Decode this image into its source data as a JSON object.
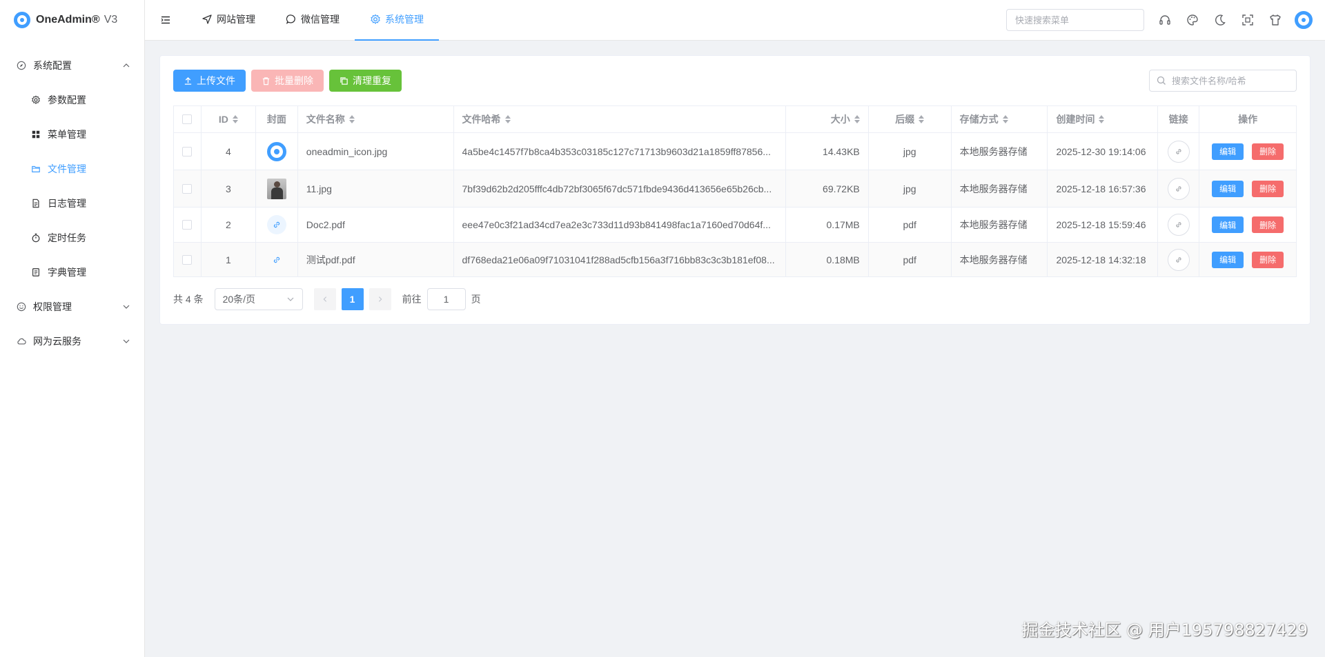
{
  "app": {
    "logo_text": "OneAdmin®",
    "version": "V3"
  },
  "sidebar": {
    "groups": [
      {
        "label": "系统配置",
        "icon": "compass-icon",
        "expanded": true,
        "items": [
          {
            "label": "参数配置",
            "icon": "gear-icon"
          },
          {
            "label": "菜单管理",
            "icon": "grid-icon"
          },
          {
            "label": "文件管理",
            "icon": "folder-icon",
            "active": true
          },
          {
            "label": "日志管理",
            "icon": "document-icon"
          },
          {
            "label": "定时任务",
            "icon": "stopwatch-icon"
          },
          {
            "label": "字典管理",
            "icon": "notebook-icon"
          }
        ]
      },
      {
        "label": "权限管理",
        "icon": "smile-icon",
        "expanded": false
      },
      {
        "label": "网为云服务",
        "icon": "cloud-icon",
        "expanded": false
      }
    ]
  },
  "header": {
    "tabs": [
      {
        "label": "网站管理",
        "icon": "navigation-icon"
      },
      {
        "label": "微信管理",
        "icon": "chat-icon"
      },
      {
        "label": "系统管理",
        "icon": "gear-icon",
        "active": true
      }
    ],
    "search_placeholder": "快速搜索菜单",
    "icons": [
      "headset-icon",
      "palette-icon",
      "moon-icon",
      "fullscreen-icon",
      "shirt-icon"
    ]
  },
  "toolbar": {
    "upload_label": "上传文件",
    "batch_delete_label": "批量删除",
    "clean_dup_label": "清理重复",
    "search_placeholder": "搜索文件名称/哈希"
  },
  "table": {
    "columns": {
      "id": "ID",
      "cover": "封面",
      "name": "文件名称",
      "hash": "文件哈希",
      "size": "大小",
      "ext": "后缀",
      "storage": "存储方式",
      "created": "创建时间",
      "link": "链接",
      "actions": "操作"
    },
    "rows": [
      {
        "id": "4",
        "cover": "logo",
        "name": "oneadmin_icon.jpg",
        "hash": "4a5be4c1457f7b8ca4b353c03185c127c71713b9603d21a1859ff87856...",
        "size": "14.43KB",
        "ext": "jpg",
        "storage": "本地服务器存储",
        "created": "2025-12-30 19:14:06"
      },
      {
        "id": "3",
        "cover": "photo",
        "name": "11.jpg",
        "hash": "7bf39d62b2d205fffc4db72bf3065f67dc571fbde9436d413656e65b26cb...",
        "size": "69.72KB",
        "ext": "jpg",
        "storage": "本地服务器存储",
        "created": "2025-12-18 16:57:36"
      },
      {
        "id": "2",
        "cover": "link",
        "name": "Doc2.pdf",
        "hash": "eee47e0c3f21ad34cd7ea2e3c733d11d93b841498fac1a7160ed70d64f...",
        "size": "0.17MB",
        "ext": "pdf",
        "storage": "本地服务器存储",
        "created": "2025-12-18 15:59:46"
      },
      {
        "id": "1",
        "cover": "link",
        "name": "测试pdf.pdf",
        "hash": "df768eda21e06a09f71031041f288ad5cfb156a3f716bb83c3c3b181ef08...",
        "size": "0.18MB",
        "ext": "pdf",
        "storage": "本地服务器存储",
        "created": "2025-12-18 14:32:18"
      }
    ],
    "edit_label": "编辑",
    "delete_label": "删除"
  },
  "pagination": {
    "total_text": "共 4 条",
    "page_size": "20条/页",
    "current_page": "1",
    "goto_label": "前往",
    "goto_value": "1",
    "page_suffix": "页"
  },
  "watermark": "掘金技术社区 @ 用户195798827429",
  "colors": {
    "primary": "#409eff",
    "danger": "#f56c6c",
    "success": "#67c23a"
  }
}
